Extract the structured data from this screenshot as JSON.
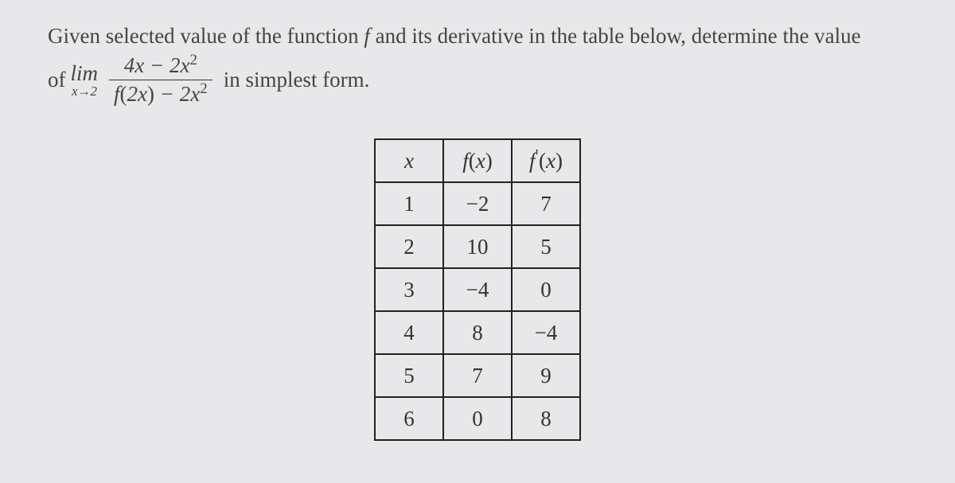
{
  "problem": {
    "line1_prefix": "Given selected value of the function ",
    "line1_f": "f",
    "line1_suffix": " and its derivative in the table below, determine the value",
    "of": "of ",
    "lim_label": "lim",
    "lim_sub": "x→2",
    "numerator": "4x − 2x",
    "num_exp": "2",
    "denominator_pre": "f",
    "denominator_open": "(",
    "denominator_arg": "2x",
    "denominator_close": ")",
    "denominator_mid": " − 2x",
    "den_exp": "2",
    "suffix": " in simplest form."
  },
  "table": {
    "headers": {
      "x": "x",
      "fx_f": "f",
      "fx_open": "(",
      "fx_var": "x",
      "fx_close": ")",
      "fpx_f": "f",
      "fpx_prime": "′",
      "fpx_open": "(",
      "fpx_var": "x",
      "fpx_close": ")"
    },
    "rows": [
      {
        "x": "1",
        "fx": "−2",
        "fpx": "7"
      },
      {
        "x": "2",
        "fx": "10",
        "fpx": "5"
      },
      {
        "x": "3",
        "fx": "−4",
        "fpx": "0"
      },
      {
        "x": "4",
        "fx": "8",
        "fpx": "−4"
      },
      {
        "x": "5",
        "fx": "7",
        "fpx": "9"
      },
      {
        "x": "6",
        "fx": "0",
        "fpx": "8"
      }
    ]
  }
}
